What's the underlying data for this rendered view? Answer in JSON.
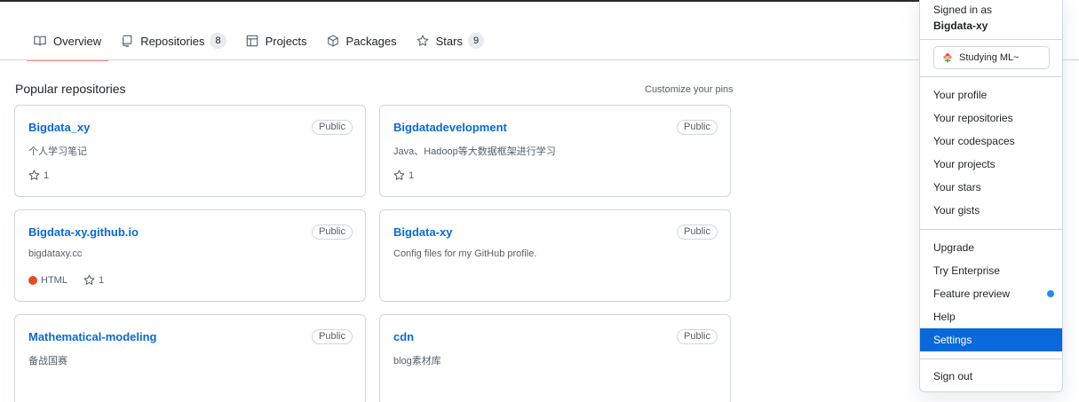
{
  "tabs": [
    {
      "label": "Overview",
      "icon": "book-icon",
      "active": true
    },
    {
      "label": "Repositories",
      "icon": "repo-icon",
      "count": "8"
    },
    {
      "label": "Projects",
      "icon": "table-icon"
    },
    {
      "label": "Packages",
      "icon": "package-icon"
    },
    {
      "label": "Stars",
      "icon": "star-icon",
      "count": "9"
    }
  ],
  "pinned": {
    "title": "Popular repositories",
    "customize": "Customize your pins",
    "repos": [
      {
        "name": "Bigdata_xy",
        "visibility": "Public",
        "description": "个人学习笔记",
        "stars": "1"
      },
      {
        "name": "Bigdatadevelopment",
        "visibility": "Public",
        "description": "Java、Hadoop等大数据框架进行学习",
        "stars": "1"
      },
      {
        "name": "Bigdata-xy.github.io",
        "visibility": "Public",
        "description": "bigdataxy.cc",
        "language": "HTML",
        "language_color": "#e34c26",
        "stars": "1"
      },
      {
        "name": "Bigdata-xy",
        "visibility": "Public",
        "description": "Config files for my GitHub profile."
      },
      {
        "name": "Mathematical-modeling",
        "visibility": "Public",
        "description": "备战国赛"
      },
      {
        "name": "cdn",
        "visibility": "Public",
        "description": "blog素材库"
      }
    ]
  },
  "menu": {
    "signed_in_label": "Signed in as",
    "username": "Bigdata-xy",
    "status": "Studying ML~",
    "group1": [
      "Your profile",
      "Your repositories",
      "Your codespaces",
      "Your projects",
      "Your stars",
      "Your gists"
    ],
    "group2": [
      "Upgrade",
      "Try Enterprise",
      "Feature preview",
      "Help",
      "Settings"
    ],
    "sign_out": "Sign out",
    "active_item": "Settings"
  },
  "colors": {
    "accent": "#0969da",
    "tab_underline": "#fd8c73",
    "html": "#e34c26",
    "feature_dot": "#218bff"
  }
}
